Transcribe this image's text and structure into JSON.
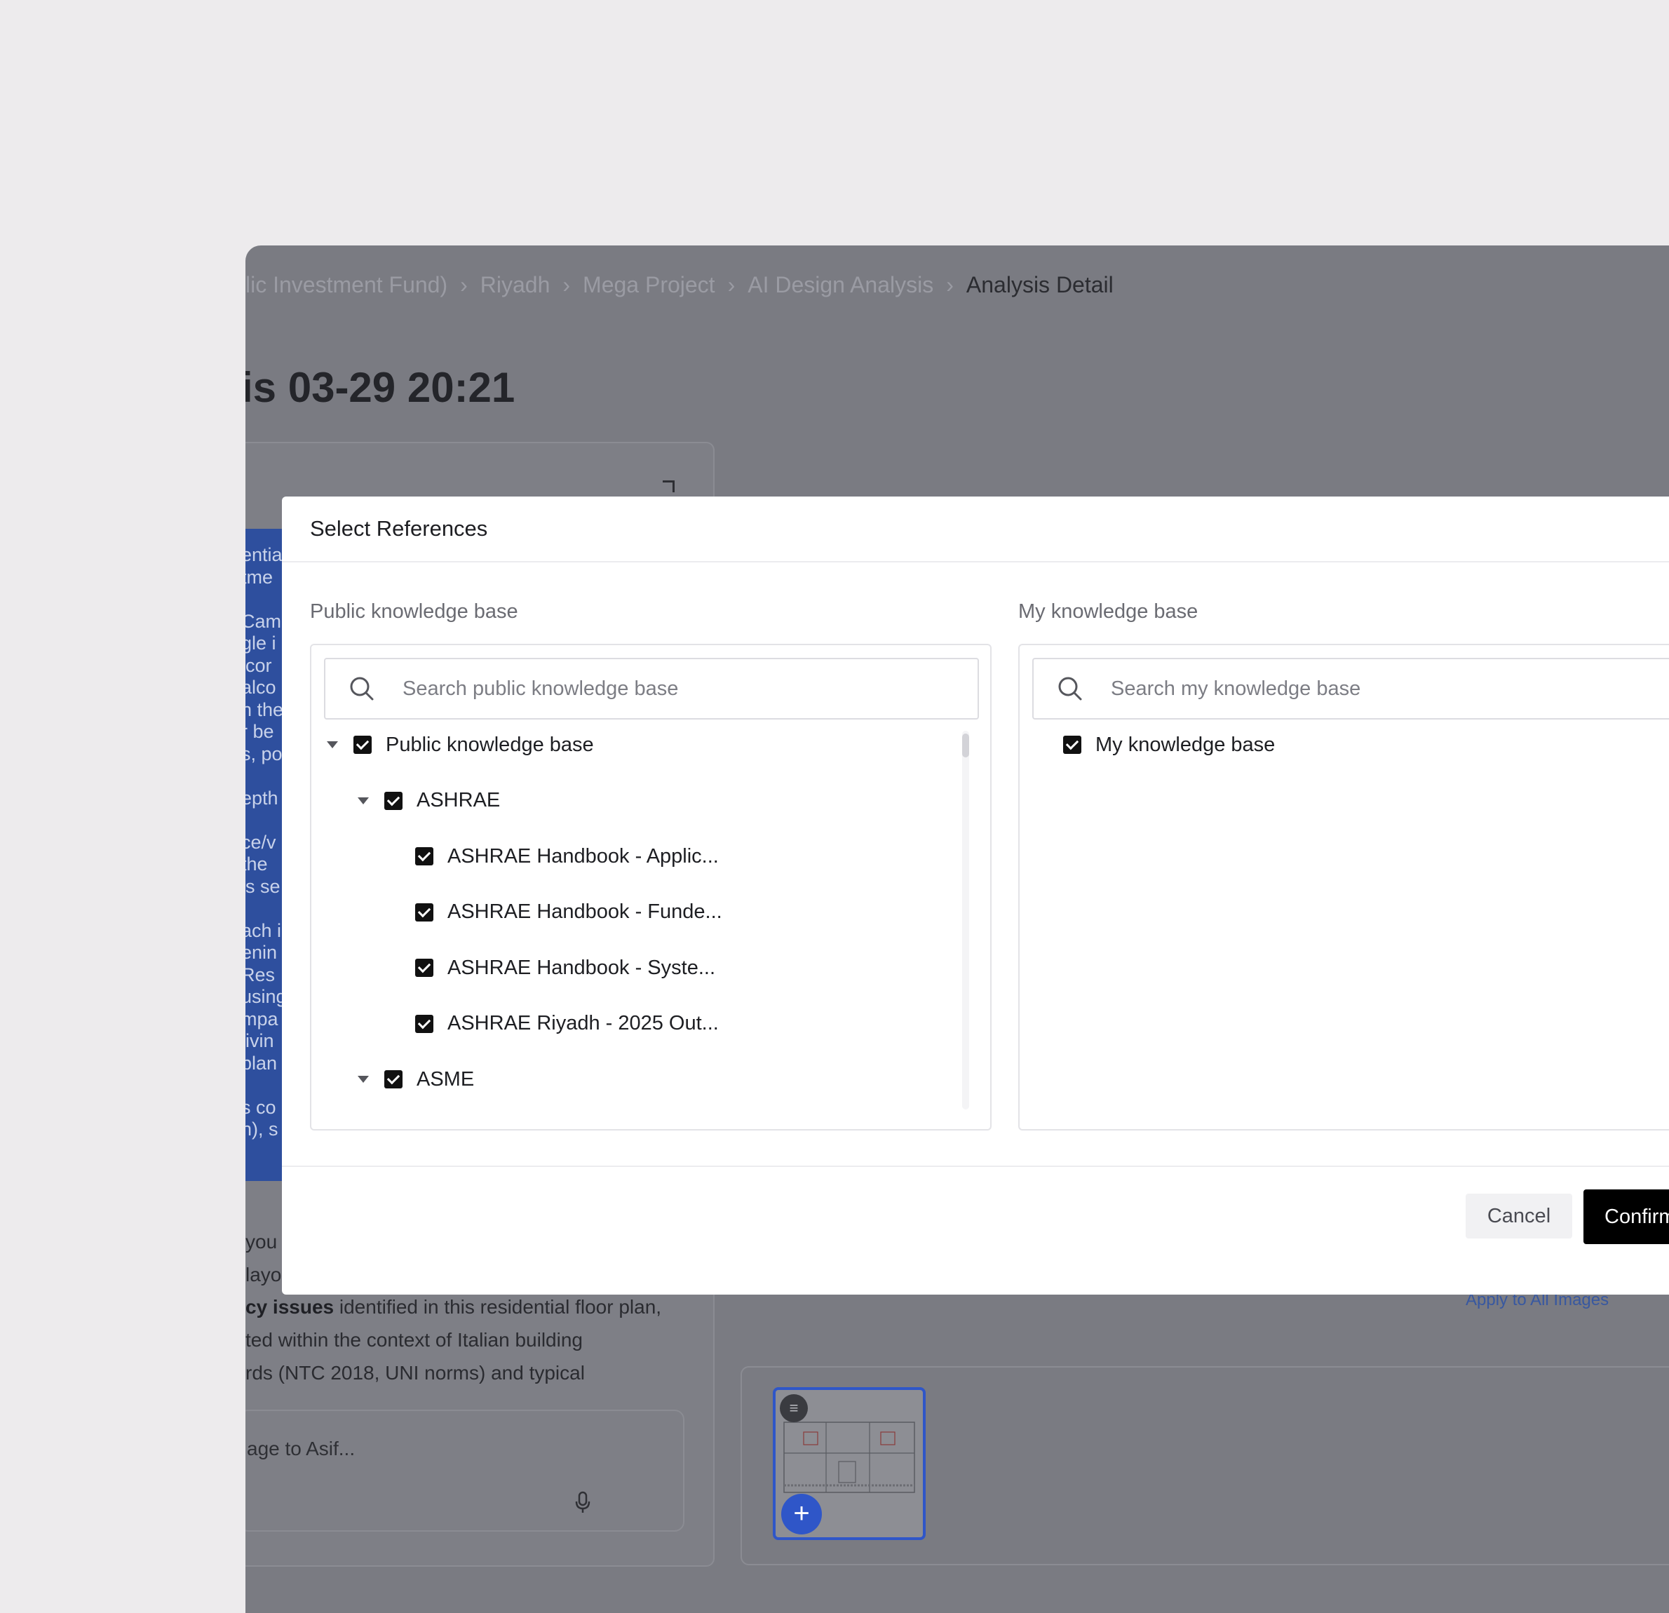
{
  "breadcrumb": {
    "items": [
      "lic Investment Fund)",
      "Riyadh",
      "Mega Project",
      "AI Design Analysis"
    ],
    "current": "Analysis Detail",
    "separator": "›"
  },
  "page_title": "is 03-29 20:21",
  "background_panel": {
    "blue_lines": [
      "entia",
      "tme",
      "",
      "Cam",
      "gle i",
      "lcor",
      "alco",
      "n the",
      "r be",
      "s, po",
      "",
      "epth",
      "",
      "ce/v",
      "the",
      "ls se",
      "",
      "ach i",
      "enin",
      "Res",
      "using",
      "mpa",
      "livin",
      "plan",
      "",
      "s co",
      "n), s"
    ],
    "chat_lines": [
      {
        "bold": "",
        "text": "you f"
      },
      {
        "bold": "",
        "text": "layo"
      },
      {
        "bold": "cy issues",
        "text": " identified in this residential floor plan,"
      },
      {
        "bold": "",
        "text": "ted within the context of Italian building"
      },
      {
        "bold": "",
        "text": "rds (NTC 2018, UNI norms) and typical"
      }
    ],
    "message_placeholder": "age to Asif...",
    "apply_link": "Apply to All Images"
  },
  "modal": {
    "title": "Select References",
    "public": {
      "label": "Public knowledge base",
      "search_placeholder": "Search public knowledge base",
      "tree": [
        {
          "label": "Public knowledge base",
          "level": 0,
          "expandable": true,
          "checked": true
        },
        {
          "label": "ASHRAE",
          "level": 1,
          "expandable": true,
          "checked": true
        },
        {
          "label": "ASHRAE Handbook - Applic...",
          "level": 2,
          "expandable": false,
          "checked": true
        },
        {
          "label": "ASHRAE Handbook - Funde...",
          "level": 2,
          "expandable": false,
          "checked": true
        },
        {
          "label": "ASHRAE Handbook - Syste...",
          "level": 2,
          "expandable": false,
          "checked": true
        },
        {
          "label": "ASHRAE Riyadh - 2025 Out...",
          "level": 2,
          "expandable": false,
          "checked": true
        },
        {
          "label": "ASME",
          "level": 1,
          "expandable": true,
          "checked": true
        }
      ]
    },
    "mine": {
      "label": "My knowledge base",
      "search_placeholder": "Search my knowledge base",
      "tree": [
        {
          "label": "My knowledge base",
          "level": 0,
          "expandable": false,
          "checked": true
        }
      ]
    },
    "cancel_label": "Cancel",
    "confirm_label": "Confirm"
  }
}
